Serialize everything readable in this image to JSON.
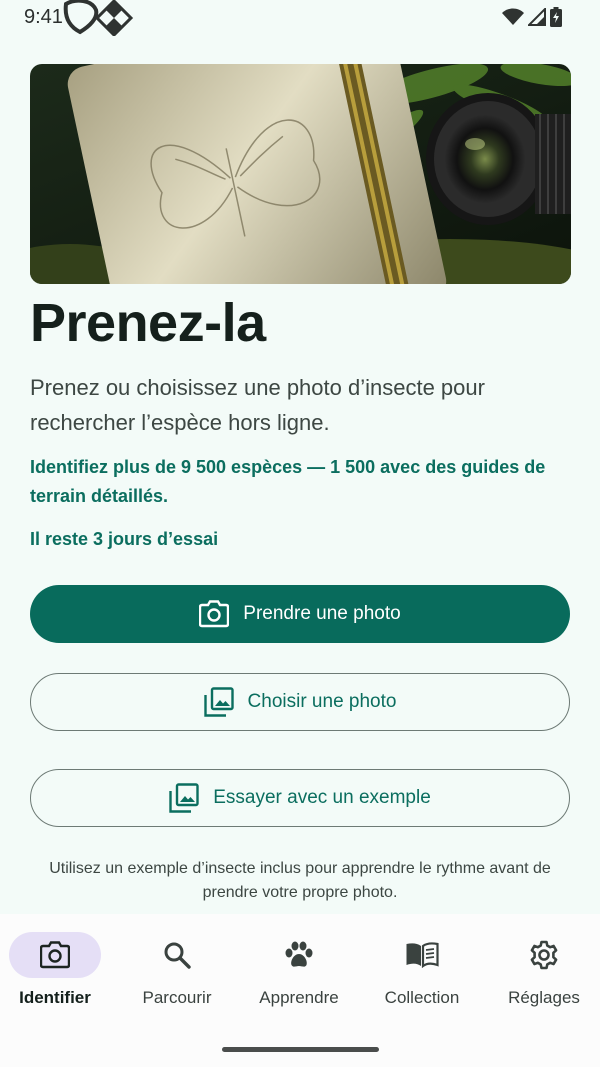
{
  "status_bar": {
    "time": "9:41",
    "icons": [
      "app-logo-icon",
      "wifi-icon",
      "signal-icon",
      "battery-icon"
    ]
  },
  "hero": {
    "image": "notebook-and-camera-lens-photo"
  },
  "main": {
    "title": "Prenez-la",
    "description": "Prenez ou choisissez une photo d’insecte pour rechercher l’espèce hors ligne.",
    "highlight": "Identifiez plus de 9 500 espèces — 1 500 avec des guides de terrain détaillés.",
    "trial": "Il reste 3 jours d’essai"
  },
  "buttons": {
    "take_photo": "Prendre une photo",
    "choose_photo": "Choisir une photo",
    "try_example": "Essayer avec un exemple"
  },
  "hint": "Utilisez un exemple d’insecte inclus pour apprendre le rythme avant de prendre votre propre photo.",
  "nav": {
    "items": [
      {
        "label": "Identifier",
        "icon": "camera-icon",
        "active": true
      },
      {
        "label": "Parcourir",
        "icon": "search-icon",
        "active": false
      },
      {
        "label": "Apprendre",
        "icon": "paw-icon",
        "active": false
      },
      {
        "label": "Collection",
        "icon": "book-icon",
        "active": false
      },
      {
        "label": "Réglages",
        "icon": "gear-icon",
        "active": false
      }
    ]
  },
  "colors": {
    "background": "#f3fbf8",
    "accent": "#086b5c",
    "accent_text": "#0b6e5f",
    "nav_active_pill": "#e5dff6"
  }
}
